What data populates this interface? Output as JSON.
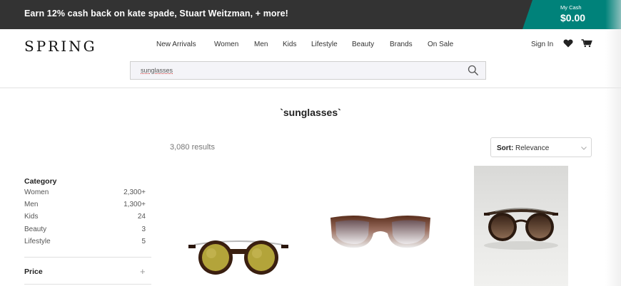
{
  "promo": {
    "text": "Earn 12% cash back on kate spade, Stuart Weitzman, + more!",
    "cash_label": "My Cash",
    "cash_amount": "$0.00"
  },
  "header": {
    "logo": "SPRING",
    "nav": [
      "New Arrivals",
      "Women",
      "Men",
      "Kids",
      "Lifestyle",
      "Beauty",
      "Brands",
      "On Sale"
    ],
    "sign_in": "Sign In",
    "icons": [
      "heart-icon",
      "cart-icon"
    ]
  },
  "search": {
    "value": "sunglasses",
    "icon": "search-icon"
  },
  "main": {
    "title": "`sunglasses`",
    "results": "3,080 results",
    "sort_key": "Sort:",
    "sort_value": "Relevance"
  },
  "filters": {
    "category_title": "Category",
    "categories": [
      {
        "name": "Women",
        "count": "2,300+"
      },
      {
        "name": "Men",
        "count": "1,300+"
      },
      {
        "name": "Kids",
        "count": "24"
      },
      {
        "name": "Beauty",
        "count": "3"
      },
      {
        "name": "Lifestyle",
        "count": "5"
      }
    ],
    "price_title": "Price",
    "price_toggle": "+"
  },
  "colors": {
    "promo_bg": "#333333",
    "cash_bg": "#00827a"
  }
}
